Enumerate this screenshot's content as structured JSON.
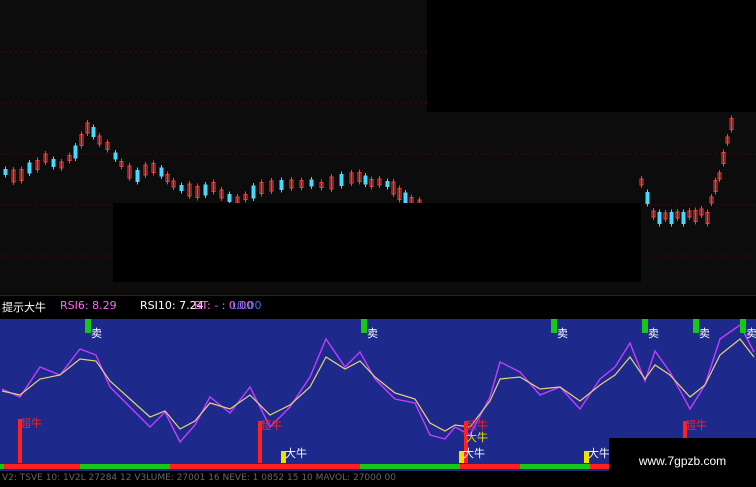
{
  "indicator_header": {
    "name": "提示大牛",
    "rsi6_label": "RSI6: 8.29",
    "rsi10_label": "RSI10: 7.24",
    "bt_label": "BT: - : 0.00",
    "bt_value": "10.00"
  },
  "signals": {
    "sell_glyph": "卖",
    "chao_label": "超牛",
    "da_label": "大牛"
  },
  "bottom_text": "V2: TSVE 10: 1V2L 27284 12  V3LUME: 27001 16  NEVE: 1 0852 15 10  MAVOL: 27000 00",
  "watermark": "www.7gpzb.com",
  "colors": {
    "price_bg": "#0c0c0c",
    "indicator_bg": "#1d2a8c",
    "up_candle": "#ff3b3b",
    "down_candle": "#48d8ff",
    "rsi_fast": "#c43cff",
    "rsi_slow": "#e8d17a",
    "sell_green": "#18c818",
    "bull_red": "#ff2020",
    "bull_yellow": "#f0e000"
  }
}
